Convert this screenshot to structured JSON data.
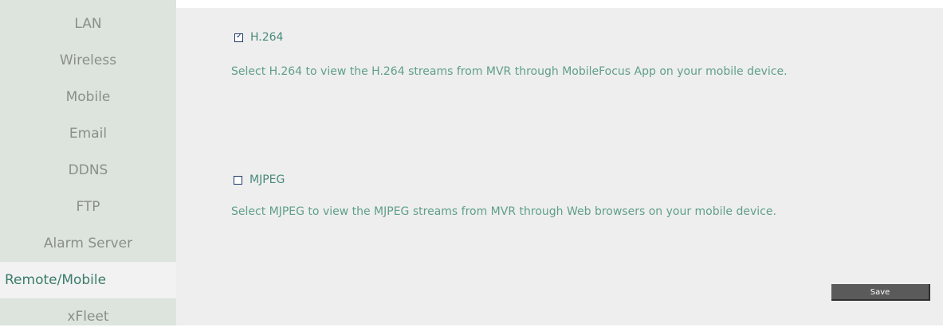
{
  "sidebar": {
    "items": [
      {
        "label": "LAN"
      },
      {
        "label": "Wireless"
      },
      {
        "label": "Mobile"
      },
      {
        "label": "Email"
      },
      {
        "label": "DDNS"
      },
      {
        "label": "FTP"
      },
      {
        "label": "Alarm Server"
      },
      {
        "label": "Remote/Mobile",
        "active": true
      },
      {
        "label": "xFleet"
      }
    ]
  },
  "options": {
    "h264": {
      "label": "H.264",
      "checked": true,
      "description": "Select H.264 to view the H.264 streams from MVR through MobileFocus App on your mobile device."
    },
    "mjpeg": {
      "label": "MJPEG",
      "checked": false,
      "description": "Select MJPEG to view the MJPEG streams from MVR through Web browsers on your mobile device."
    }
  },
  "actions": {
    "save_label": "Save"
  },
  "colors": {
    "sidebar_bg": "#dde3dd",
    "active_text": "#3b7c6a",
    "description_text": "#5f9f8a",
    "save_bg": "#5a5a5a"
  }
}
